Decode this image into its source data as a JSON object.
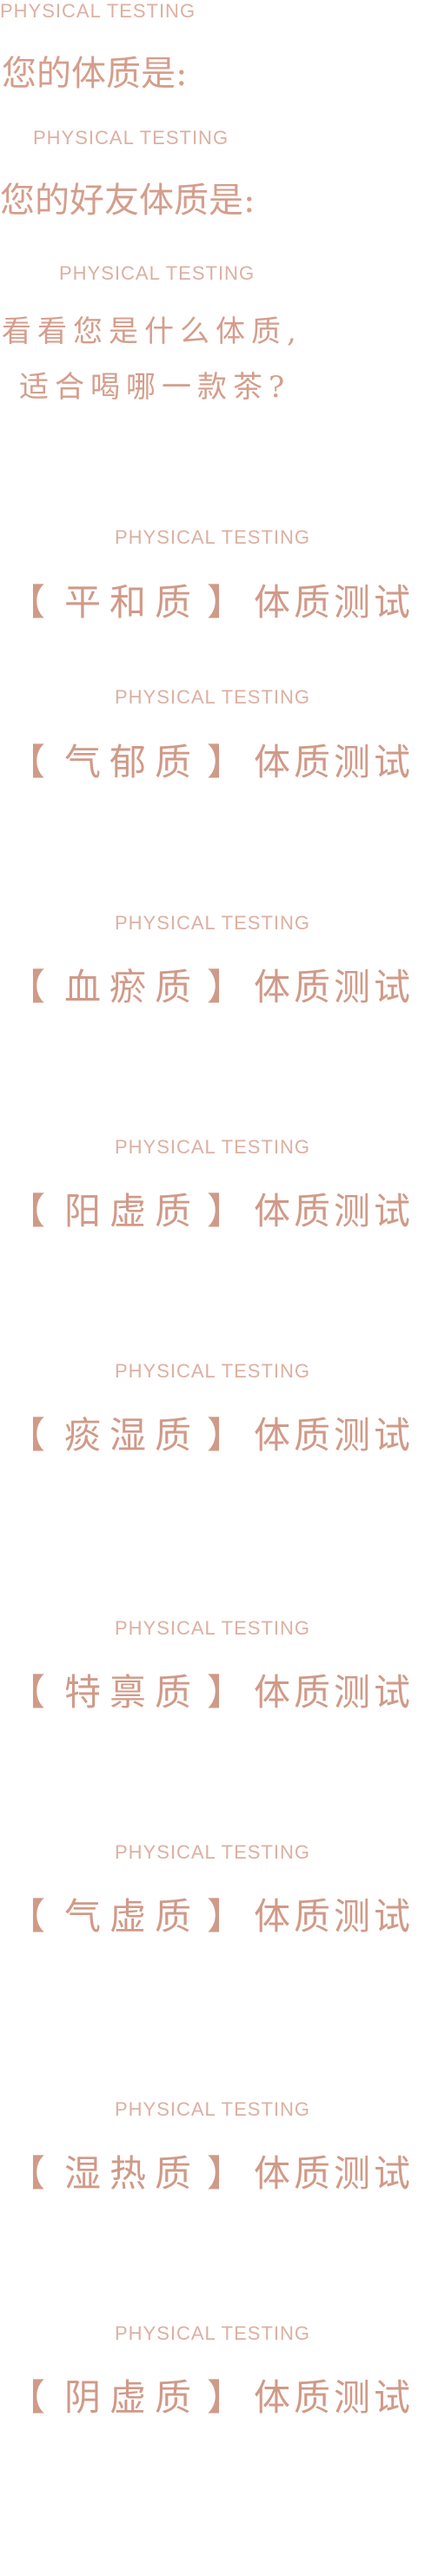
{
  "intro": {
    "eng_1": "PHYSICAL TESTING",
    "line_1": "您的体质是:",
    "eng_2": "PHYSICAL TESTING",
    "line_2": "您的好友体质是:",
    "eng_3": "PHYSICAL TESTING",
    "line_3a": "看看您是什么体质,",
    "line_3b": "适合喝哪一款茶?"
  },
  "tests": [
    {
      "eng": "PHYSICAL TESTING",
      "open": "【",
      "type": "平和质",
      "close": "】",
      "suffix": "体质测试"
    },
    {
      "eng": "PHYSICAL TESTING",
      "open": "【",
      "type": "气郁质",
      "close": "】",
      "suffix": "体质测试"
    },
    {
      "eng": "PHYSICAL TESTING",
      "open": "【",
      "type": "血瘀质",
      "close": "】",
      "suffix": "体质测试"
    },
    {
      "eng": "PHYSICAL TESTING",
      "open": "【",
      "type": "阳虚质",
      "close": "】",
      "suffix": "体质测试"
    },
    {
      "eng": "PHYSICAL TESTING",
      "open": "【",
      "type": "痰湿质",
      "close": "】",
      "suffix": "体质测试"
    },
    {
      "eng": "PHYSICAL TESTING",
      "open": "【",
      "type": "特禀质",
      "close": "】",
      "suffix": "体质测试"
    },
    {
      "eng": "PHYSICAL TESTING",
      "open": "【",
      "type": "气虚质",
      "close": "】",
      "suffix": "体质测试"
    },
    {
      "eng": "PHYSICAL TESTING",
      "open": "【",
      "type": "湿热质",
      "close": "】",
      "suffix": "体质测试"
    },
    {
      "eng": "PHYSICAL TESTING",
      "open": "【",
      "type": "阴虚质",
      "close": "】",
      "suffix": "体质测试"
    }
  ],
  "colors": {
    "accent": "#d49e8c",
    "english": "#dcb0a2",
    "background": "#ffffff"
  }
}
